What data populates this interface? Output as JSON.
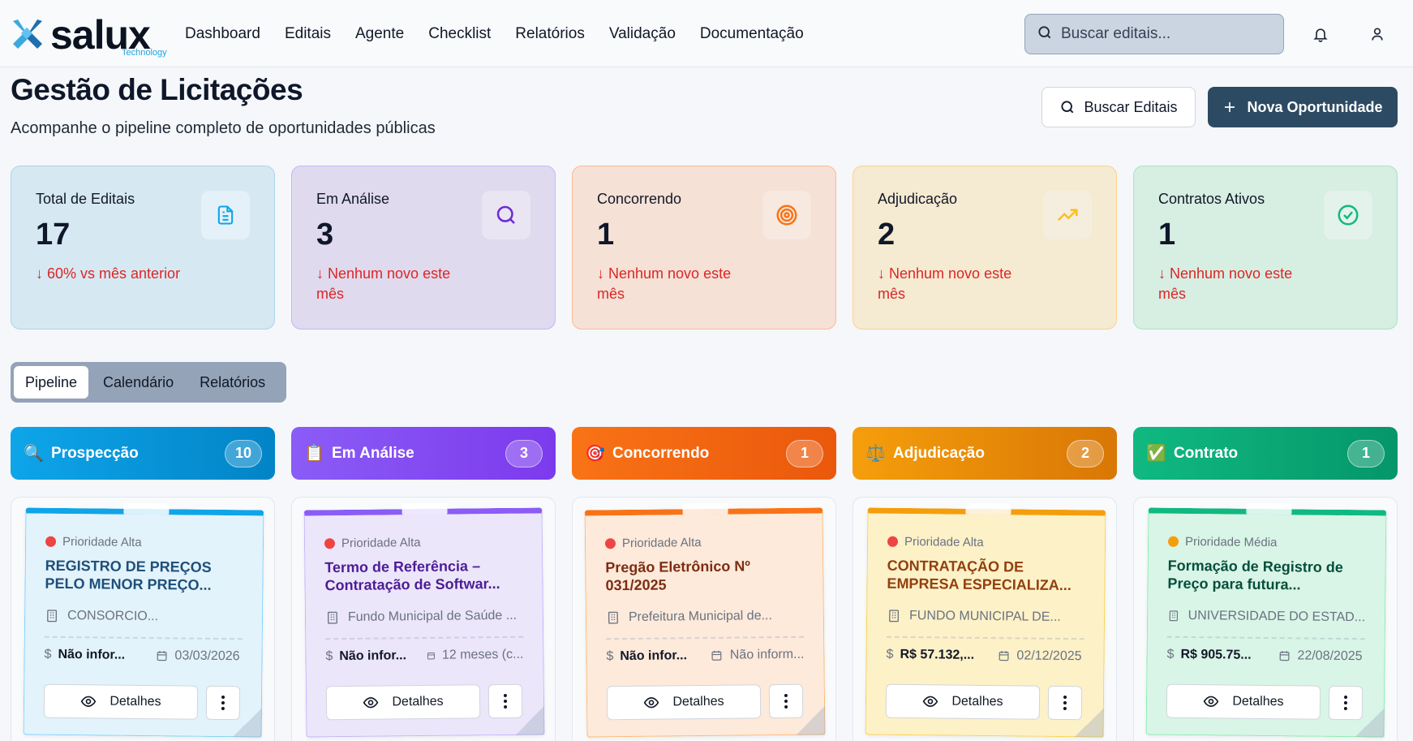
{
  "brand": {
    "name": "salux",
    "tagline": "Technology"
  },
  "nav": [
    "Dashboard",
    "Editais",
    "Agente",
    "Checklist",
    "Relatórios",
    "Validação",
    "Documentação"
  ],
  "search": {
    "placeholder": "Buscar editais..."
  },
  "header_icons": [
    "bell-icon",
    "user-icon"
  ],
  "page": {
    "title": "Gestão de Licitações",
    "subtitle": "Acompanhe o pipeline completo de oportunidades públicas",
    "btn_search": "Buscar Editais",
    "btn_new": "Nova Oportunidade"
  },
  "stats": [
    {
      "label": "Total de Editais",
      "value": "17",
      "trend": "↓ 60% vs mês anterior",
      "icon": "document-icon",
      "color": "#0ea5e9"
    },
    {
      "label": "Em Análise",
      "value": "3",
      "trend": "↓ Nenhum novo este mês",
      "icon": "search-icon",
      "color": "#7c3aed"
    },
    {
      "label": "Concorrendo",
      "value": "1",
      "trend": "↓ Nenhum novo este mês",
      "icon": "target-icon",
      "color": "#f97316"
    },
    {
      "label": "Adjudicação",
      "value": "2",
      "trend": "↓ Nenhum novo este mês",
      "icon": "trending-up-icon",
      "color": "#f59e0b"
    },
    {
      "label": "Contratos Ativos",
      "value": "1",
      "trend": "↓ Nenhum novo este mês",
      "icon": "check-circle-icon",
      "color": "#10b981"
    }
  ],
  "tabs": [
    "Pipeline",
    "Calendário",
    "Relatórios"
  ],
  "columns": [
    {
      "title": "Prospecção",
      "count": "10",
      "emoji": "🔍",
      "icon": "magnifier-emoji-icon"
    },
    {
      "title": "Em Análise",
      "count": "3",
      "emoji": "📋",
      "icon": "clipboard-emoji-icon"
    },
    {
      "title": "Concorrendo",
      "count": "1",
      "emoji": "🎯",
      "icon": "dart-emoji-icon"
    },
    {
      "title": "Adjudicação",
      "count": "2",
      "emoji": "⚖️",
      "icon": "scales-emoji-icon"
    },
    {
      "title": "Contrato",
      "count": "1",
      "emoji": "✅",
      "icon": "checkmark-emoji-icon"
    }
  ],
  "cards": [
    {
      "priority": "Prioridade Alta",
      "title": "REGISTRO DE PREÇOS PELO MENOR PREÇO...",
      "org": "CONSORCIO...",
      "value": "Não infor...",
      "date": "03/03/2026",
      "details": "Detalhes"
    },
    {
      "priority": "Prioridade Alta",
      "title": "Termo de Referência – Contratação de Softwar...",
      "org": "Fundo Municipal de Saúde ...",
      "value": "Não infor...",
      "date": "12 meses (c...",
      "details": "Detalhes"
    },
    {
      "priority": "Prioridade Alta",
      "title": "Pregão Eletrônico Nº 031/2025",
      "org": "Prefeitura Municipal de...",
      "value": "Não infor...",
      "date": "Não inform...",
      "details": "Detalhes"
    },
    {
      "priority": "Prioridade Alta",
      "title": "CONTRATAÇÃO DE EMPRESA ESPECIALIZA...",
      "org": "FUNDO MUNICIPAL DE...",
      "value": "R$ 57.132,...",
      "date": "02/12/2025",
      "details": "Detalhes"
    },
    {
      "priority": "Prioridade Média",
      "title": "Formação de Registro de Preço para futura...",
      "org": "UNIVERSIDADE DO ESTAD...",
      "value": "R$ 905.75...",
      "date": "22/08/2025",
      "details": "Detalhes"
    }
  ],
  "colors": {
    "primary": "#2d4a63",
    "alert": "#dc2626",
    "priority_high": "#ef4444",
    "priority_medium": "#f59e0b"
  }
}
